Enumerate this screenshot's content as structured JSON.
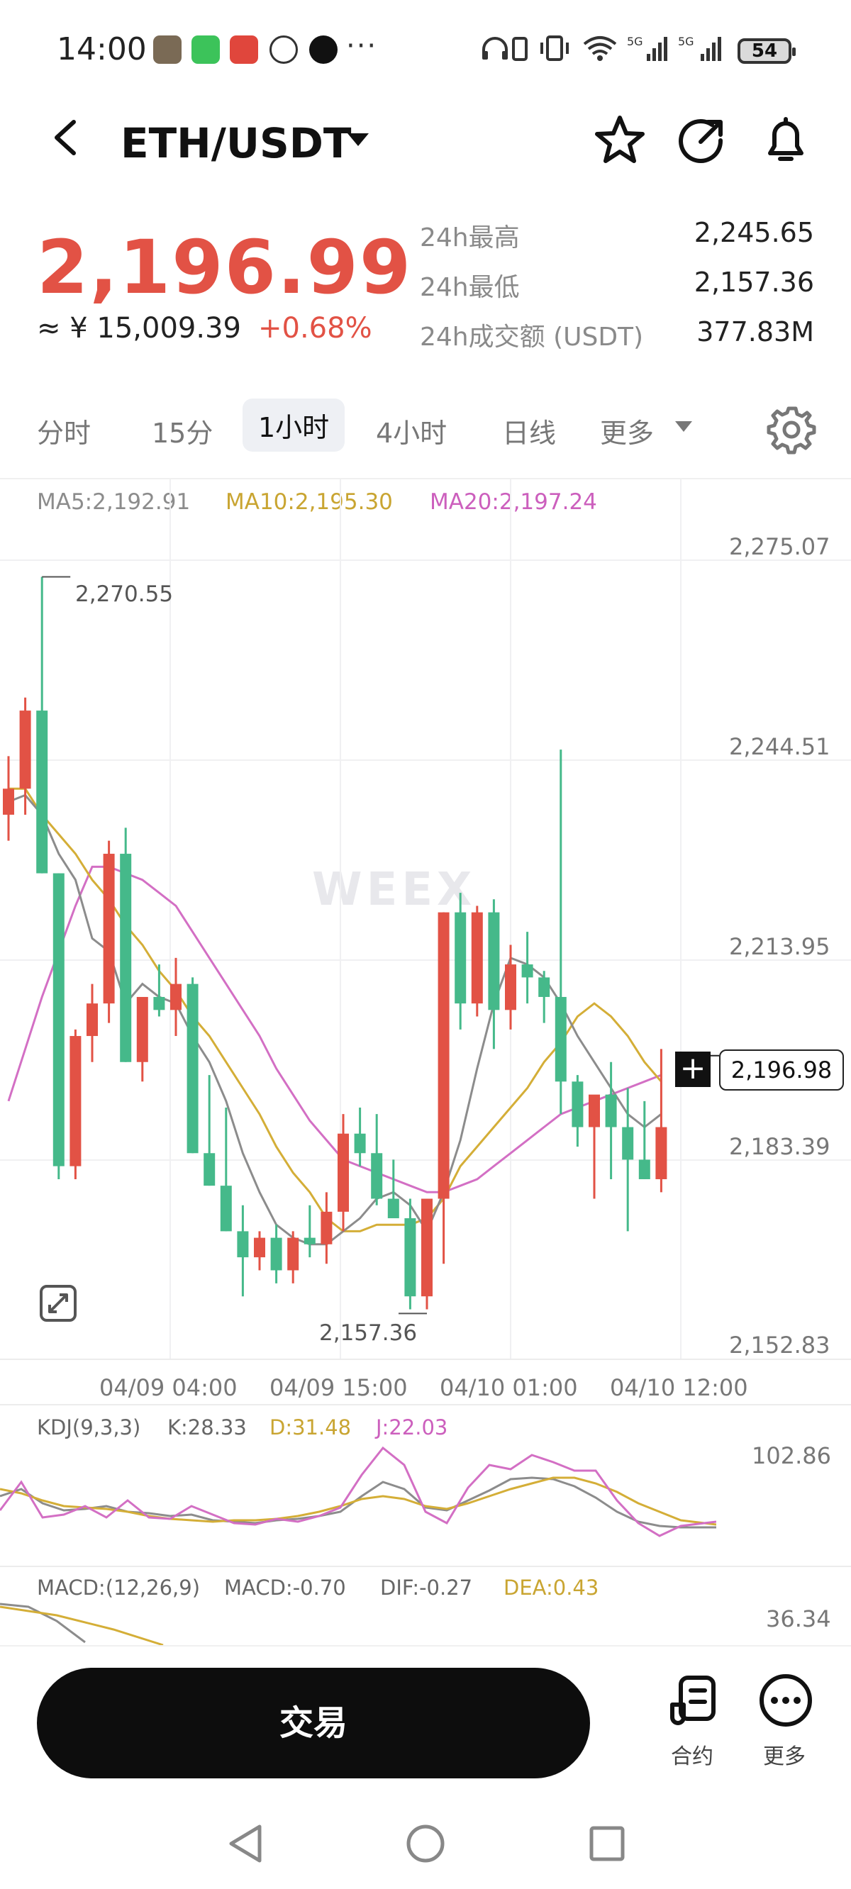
{
  "status_bar": {
    "time": "14:00",
    "battery": "54"
  },
  "header": {
    "pair": "ETH/USDT"
  },
  "ticker": {
    "price": "2,196.99",
    "cny": "≈ ¥ 15,009.39",
    "change": "+0.68%",
    "stats": [
      {
        "label": "24h最高",
        "value": "2,245.65"
      },
      {
        "label": "24h最低",
        "value": "2,157.36"
      },
      {
        "label": "24h成交额 (USDT)",
        "value": "377.83M"
      }
    ]
  },
  "tabs": [
    "分时",
    "15分",
    "1小时",
    "4小时",
    "日线",
    "更多"
  ],
  "active_tab": "1小时",
  "ma": {
    "ma5": "MA5:2,192.91",
    "ma10": "MA10:2,195.30",
    "ma20": "MA20:2,197.24"
  },
  "colors": {
    "up": "#e25245",
    "down": "#45b98a",
    "ma5": "#8c8c8c",
    "ma10": "#d4ae37",
    "ma20": "#d36fc4"
  },
  "watermark": "WEEX",
  "chart_data": {
    "type": "candlestick",
    "y_ticks": [
      "2,275.07",
      "2,244.51",
      "2,213.95",
      "2,183.39",
      "2,152.83"
    ],
    "x_ticks": [
      "04/09 04:00",
      "04/09 15:00",
      "04/10 01:00",
      "04/10 12:00"
    ],
    "max_label": "2,270.55",
    "min_label": "2,157.36",
    "last_price": "2,196.98",
    "candles": [
      [
        2234,
        2243,
        2230,
        2238
      ],
      [
        2238,
        2252,
        2234,
        2250
      ],
      [
        2250,
        2270.55,
        2225,
        2225
      ],
      [
        2225,
        2225,
        2178,
        2180
      ],
      [
        2180,
        2201,
        2178,
        2200
      ],
      [
        2200,
        2208,
        2196,
        2205
      ],
      [
        2205,
        2230,
        2202,
        2228
      ],
      [
        2228,
        2232,
        2196,
        2196
      ],
      [
        2196,
        2206,
        2193,
        2206
      ],
      [
        2206,
        2211,
        2203,
        2204
      ],
      [
        2204,
        2212,
        2200,
        2208
      ],
      [
        2208,
        2209,
        2182,
        2182
      ],
      [
        2182,
        2194,
        2177,
        2177
      ],
      [
        2177,
        2189,
        2170,
        2170
      ],
      [
        2170,
        2174,
        2160,
        2166
      ],
      [
        2166,
        2170,
        2164,
        2169
      ],
      [
        2169,
        2171,
        2162,
        2164
      ],
      [
        2164,
        2170,
        2162,
        2169
      ],
      [
        2169,
        2174,
        2166,
        2168
      ],
      [
        2168,
        2176,
        2165,
        2173
      ],
      [
        2173,
        2188,
        2170,
        2185
      ],
      [
        2185,
        2189,
        2180,
        2182
      ],
      [
        2182,
        2188,
        2174,
        2175
      ],
      [
        2175,
        2181,
        2172,
        2172
      ],
      [
        2172,
        2175,
        2158,
        2160
      ],
      [
        2160,
        2175,
        2158,
        2175
      ],
      [
        2175,
        2219,
        2165,
        2219
      ],
      [
        2219,
        2222,
        2201,
        2205
      ],
      [
        2205,
        2220,
        2203,
        2219
      ],
      [
        2219,
        2221,
        2198,
        2204
      ],
      [
        2204,
        2214,
        2201,
        2211
      ],
      [
        2211,
        2216,
        2205,
        2209
      ],
      [
        2209,
        2210,
        2202,
        2206
      ],
      [
        2206,
        2244,
        2188,
        2193
      ],
      [
        2193,
        2194,
        2183,
        2186
      ],
      [
        2186,
        2190,
        2175,
        2191
      ],
      [
        2191,
        2196,
        2178,
        2186
      ],
      [
        2186,
        2192,
        2170,
        2181
      ],
      [
        2181,
        2190,
        2178,
        2178
      ],
      [
        2178,
        2198,
        2176,
        2186
      ]
    ],
    "ma5": [
      2236,
      2237,
      2234,
      2228,
      2224,
      2215,
      2213,
      2205,
      2208,
      2206,
      2205,
      2200,
      2196,
      2190,
      2182,
      2176,
      2171,
      2169,
      2168,
      2168,
      2170,
      2172,
      2175,
      2176,
      2174,
      2170,
      2176,
      2184,
      2195,
      2205,
      2212,
      2211,
      2209,
      2205,
      2200,
      2196,
      2192,
      2188,
      2186,
      2188
    ],
    "ma10": [
      2238,
      2238,
      2234,
      2231,
      2228,
      2224,
      2221,
      2217,
      2214,
      2210,
      2207,
      2203,
      2200,
      2196,
      2192,
      2188,
      2183,
      2179,
      2176,
      2172,
      2170,
      2170,
      2171,
      2171,
      2171,
      2172,
      2175,
      2180,
      2183,
      2186,
      2189,
      2192,
      2196,
      2199,
      2203,
      2205,
      2203,
      2200,
      2196,
      2193
    ],
    "ma20": [
      2190,
      2198,
      2206,
      2213,
      2220,
      2226,
      2226,
      2225,
      2224,
      2222,
      2220,
      2216,
      2212,
      2208,
      2204,
      2200,
      2195,
      2191,
      2187,
      2184,
      2181,
      2180,
      2179,
      2178,
      2177,
      2176,
      2176,
      2177,
      2178,
      2180,
      2182,
      2184,
      2186,
      2188,
      2189,
      2190,
      2191,
      2192,
      2193,
      2194
    ]
  },
  "kdj": {
    "label": "KDJ(9,3,3)",
    "k": "K:28.33",
    "d": "D:31.48",
    "j": "J:22.03",
    "axis": "102.86"
  },
  "macd": {
    "label": "MACD:(12,26,9)",
    "macd": "MACD:-0.70",
    "dif": "DIF:-0.27",
    "dea": "DEA:0.43",
    "axis": "36.34"
  },
  "bottom": {
    "trade": "交易",
    "contract": "合约",
    "more": "更多"
  }
}
